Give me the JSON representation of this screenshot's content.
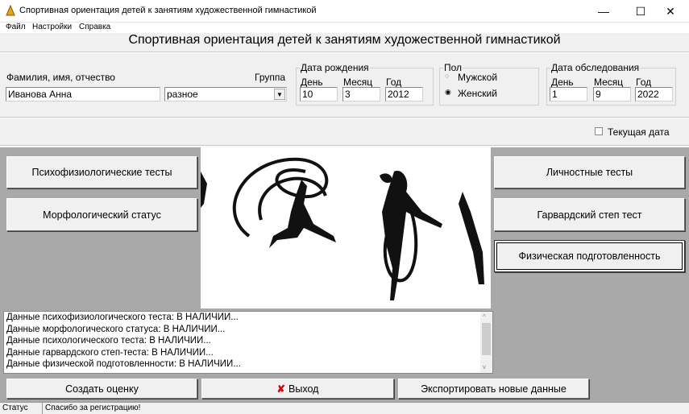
{
  "window": {
    "title": "Спортивная ориентация детей к занятиям художественной гимнастикой",
    "minimize": "—",
    "maximize": "☐",
    "close": "✕"
  },
  "menu": [
    "Файл",
    "Настройки",
    "Справка"
  ],
  "heading": "Спортивная ориентация детей к занятиям художественной гимнастикой",
  "form": {
    "fio_label": "Фамилия, имя, отчество",
    "fio_value": "Иванова Анна",
    "group_label": "Группа",
    "group_value": "разное",
    "birth": {
      "caption": "Дата рождения",
      "day_label": "День",
      "day": "10",
      "month_label": "Месяц",
      "month": "3",
      "year_label": "Год",
      "year": "2012"
    },
    "sex": {
      "caption": "Пол",
      "male": "Мужской",
      "female": "Женский",
      "selected": "female"
    },
    "exam": {
      "caption": "Дата обследования",
      "day_label": "День",
      "day": "1",
      "month_label": "Месяц",
      "month": "9",
      "year_label": "Год",
      "year": "2022"
    },
    "current_date_label": "Текущая дата",
    "current_date_checked": false
  },
  "buttons": {
    "psycho": "Психофизиологические тесты",
    "morph": "Морфологический статус",
    "personal": "Личностные тесты",
    "harvard": "Гарвардский степ тест",
    "physical": "Физическая подготовленность",
    "create": "Создать оценку",
    "exit": "Выход",
    "export": "Экспортировать новые данные"
  },
  "log": [
    "Данные психофизиологического теста: В НАЛИЧИИ...",
    "Данные морфологического статуса: В НАЛИЧИИ...",
    "Данные психологического теста: В НАЛИЧИИ...",
    "Данные гарвардского степ-теста: В НАЛИЧИИ...",
    "Данные физической подготовленности: В НАЛИЧИИ..."
  ],
  "status": {
    "label": "Статус",
    "text": "Спасибо за регистрацию!"
  }
}
